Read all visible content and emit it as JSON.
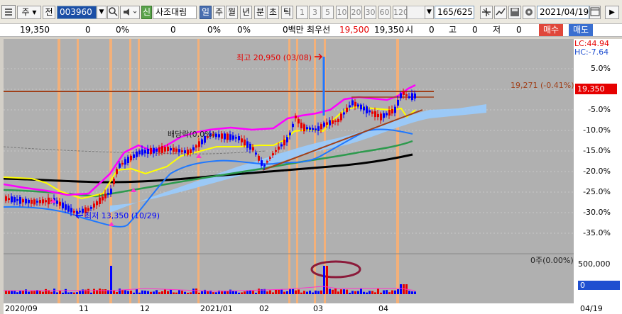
{
  "toolbar": {
    "market_type": "주",
    "all_label": "전",
    "stock_code": "003960",
    "new_badge": "신",
    "stock_name": "사조대림",
    "period_buttons": [
      "일",
      "주",
      "월",
      "년",
      "분",
      "초",
      "틱"
    ],
    "count_buttons": [
      "1",
      "3",
      "5",
      "10",
      "20",
      "30",
      "60",
      "120"
    ],
    "view_count": "165/625",
    "date": "2021/04/19"
  },
  "pricebar": {
    "price": "19,350",
    "change": "0",
    "change_pct": "0%",
    "vol": "0",
    "vol_pct": "0%",
    "pct3": "0%",
    "amount_label": "0백만",
    "priority_sell_label": "최우선",
    "priority_sell": "19,500",
    "priority_buy": "19,350",
    "open_label": "시",
    "open": "0",
    "high_label": "고",
    "high": "0",
    "low_label": "저",
    "low": "0",
    "buy_button": "매수",
    "sell_button": "매도"
  },
  "chart": {
    "lc_label": "LC:44.94",
    "hc_label": "HC:-7.64",
    "high_annotation": "최고 20,950 (03/08)",
    "low_annotation": "최저 13,350 (10/29)",
    "dividend_annotation": "배당락(0,0%)",
    "ref_line_label": "19,271 (-0.41%)",
    "current_price_tag": "19,350",
    "volume_label": "0주(0.00%)",
    "volume_scale": "500,000",
    "volume_current": "0",
    "y_labels": [
      "5.0%",
      "0.0%",
      "-5.0%",
      "-10.0%",
      "-15.0%",
      "-20.0%",
      "-25.0%",
      "-30.0%",
      "-35.0%"
    ],
    "x_labels": [
      "2020/09",
      "11",
      "12",
      "2021/01",
      "02",
      "03",
      "04"
    ],
    "x_right_label": "04/19",
    "colors": {
      "up": "#e60000",
      "down": "#0000ff",
      "bollinger": "#ff00ff",
      "signal": "#ffff00",
      "ma_black": "#000000",
      "ma_green": "#2e9a4e",
      "ma_blue": "#1f78ff",
      "cloud": "#99ccff",
      "highlight": "#ffb070",
      "trend": "#a0401a"
    }
  }
}
